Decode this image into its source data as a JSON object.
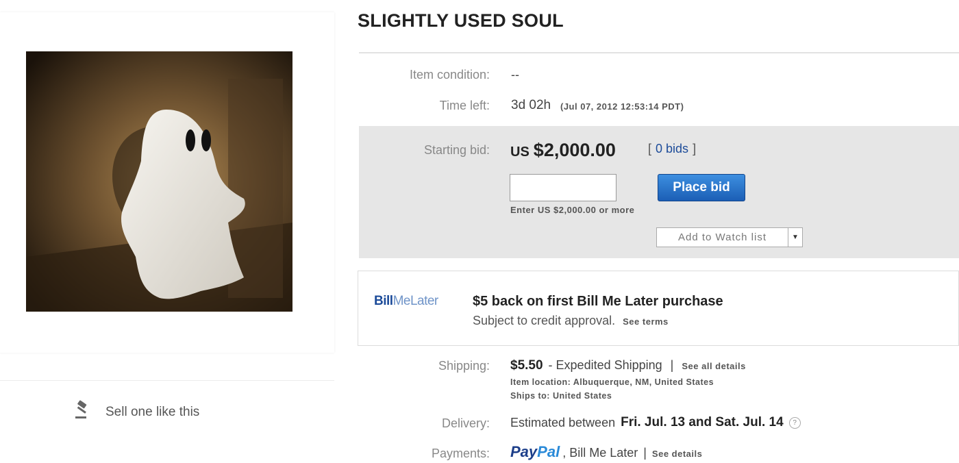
{
  "listing": {
    "title": "SLIGHTLY USED SOUL"
  },
  "sell": {
    "label": "Sell one like this"
  },
  "condition": {
    "label": "Item condition:",
    "value": "--"
  },
  "time_left": {
    "label": "Time left:",
    "value": "3d 02h",
    "end": "(Jul 07, 2012 12:53:14 PDT)"
  },
  "bid": {
    "label": "Starting bid:",
    "currency": "US",
    "amount": "$2,000.00",
    "bids_open": "[",
    "bids": "0 bids",
    "bids_close": "]",
    "input_value": "",
    "button": "Place bid",
    "hint": "Enter US $2,000.00 or more",
    "watch": "Add to Watch list"
  },
  "bill_me_later": {
    "logo_bold": "Bill",
    "logo_light": "MeLater",
    "headline": "$5 back on first Bill Me Later purchase",
    "sub": "Subject to credit approval.",
    "terms": "See terms"
  },
  "shipping": {
    "label": "Shipping:",
    "price": "$5.50",
    "method": "- Expedited Shipping",
    "sep": "|",
    "details": "See all details",
    "location": "Item location: Albuquerque, NM, United States",
    "ships_to": "Ships to: United States"
  },
  "delivery": {
    "label": "Delivery:",
    "text": "Estimated between",
    "dates": "Fri. Jul. 13 and Sat. Jul. 14"
  },
  "payments": {
    "label": "Payments:",
    "paypal_a": "Pay",
    "paypal_b": "Pal",
    "other": ", Bill Me Later",
    "sep": "|",
    "details": "See details"
  },
  "colors": {
    "button_blue": "#1b5eb5",
    "bid_box": "#e6e6e6",
    "link_blue": "#1c4b99"
  }
}
